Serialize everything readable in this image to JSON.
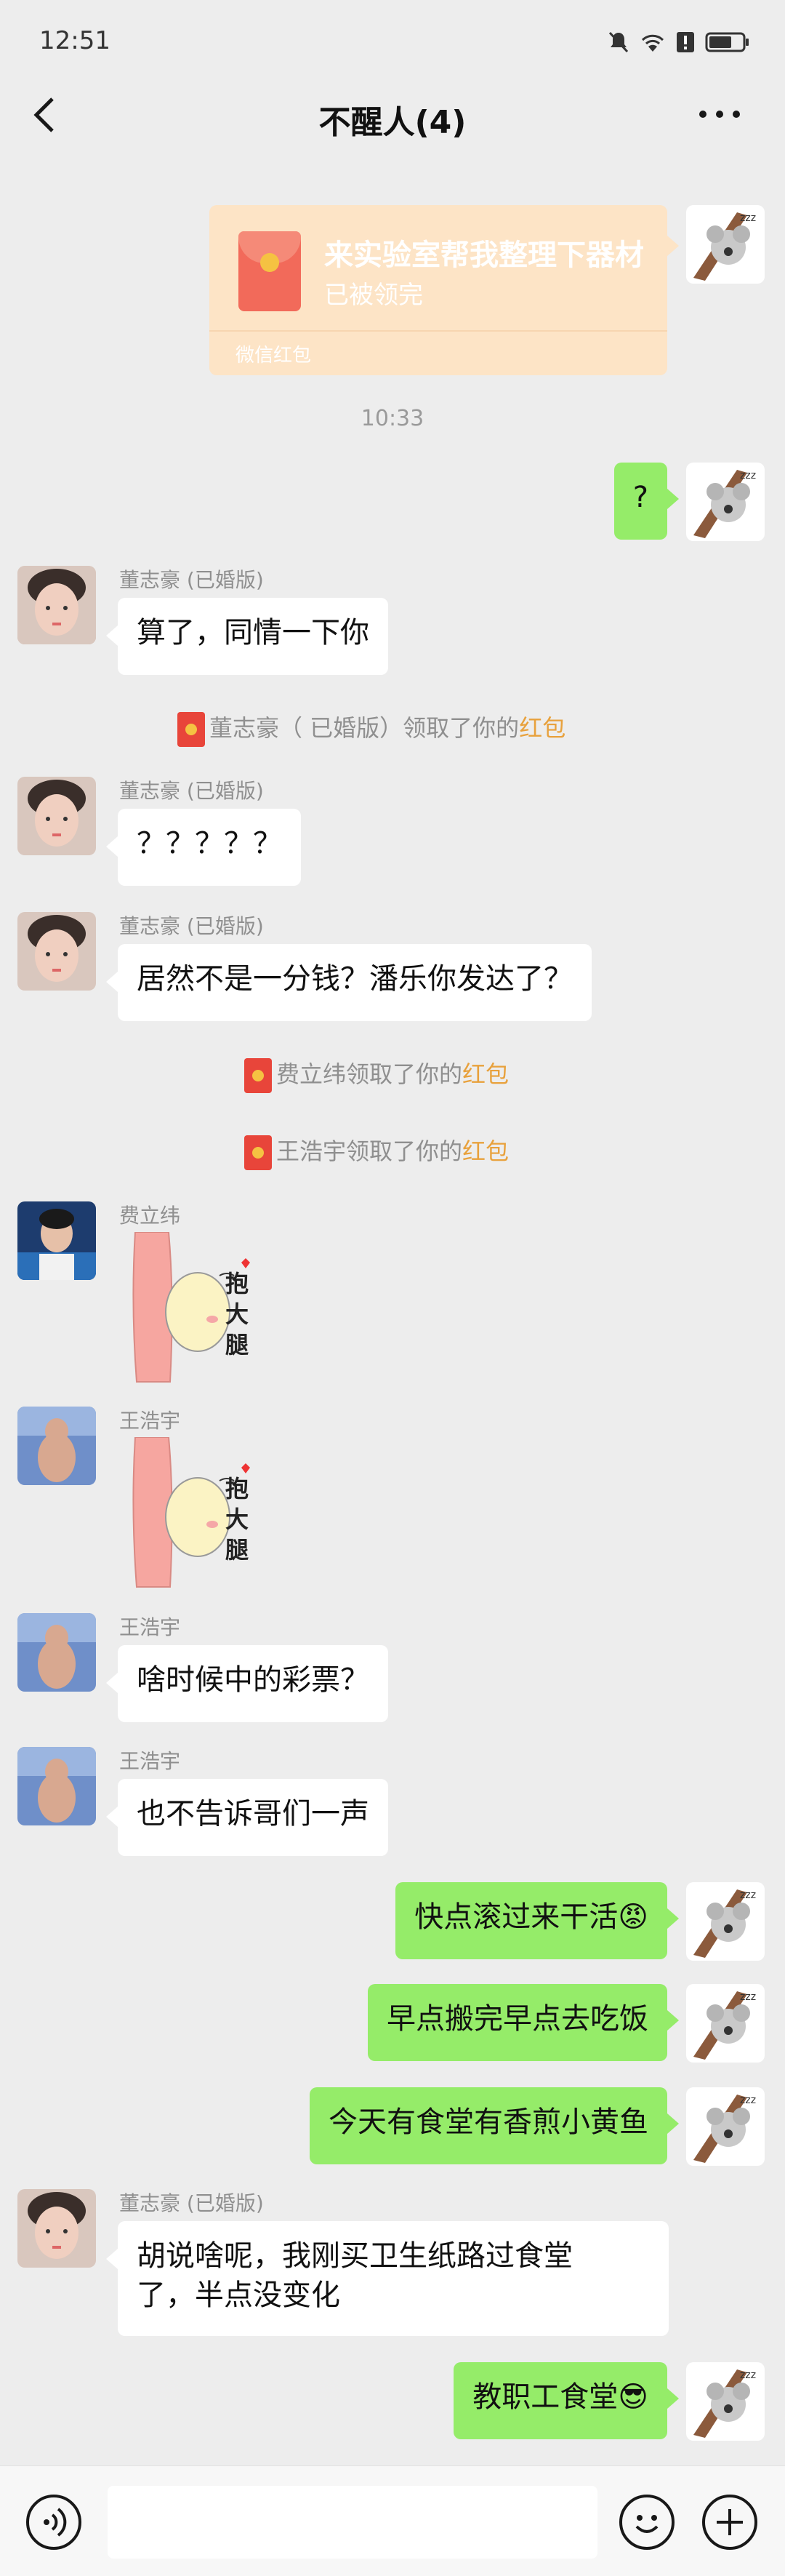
{
  "status_bar": {
    "time": "12:51"
  },
  "header": {
    "title": "不醒人(4)"
  },
  "red_packet_card": {
    "message": "来实验室帮我整理下器材",
    "status": "已被领完",
    "footer": "微信红包"
  },
  "timestamp": "10:33",
  "messages": {
    "m1": {
      "text": "?"
    },
    "m2": {
      "sender": "董志豪 (已婚版)",
      "text": "算了，同情一下你"
    },
    "s1": {
      "prefix": "董志豪（ 已婚版）领取了你的",
      "link": "红包"
    },
    "m3": {
      "sender": "董志豪 (已婚版)",
      "text": "？？？？？"
    },
    "m4": {
      "sender": "董志豪 (已婚版)",
      "text": "居然不是一分钱？潘乐你发达了？"
    },
    "s2": {
      "prefix": "费立纬领取了你的",
      "link": "红包"
    },
    "s3": {
      "prefix": "王浩宇领取了你的",
      "link": "红包"
    },
    "m5": {
      "sender": "费立纬",
      "sticker_text": "抱大腿"
    },
    "m6": {
      "sender": "王浩宇",
      "sticker_text": "抱大腿"
    },
    "m7": {
      "sender": "王浩宇",
      "text": "啥时候中的彩票？"
    },
    "m8": {
      "sender": "王浩宇",
      "text": "也不告诉哥们一声"
    },
    "m9": {
      "text": "快点滚过来干活😡"
    },
    "m10": {
      "text": "早点搬完早点去吃饭"
    },
    "m11": {
      "text": "今天有食堂有香煎小黄鱼"
    },
    "m12": {
      "sender": "董志豪 (已婚版)",
      "text_line1": "胡说啥呢，我刚买卫生纸路过食堂",
      "text_line2": "了，半点没变化"
    },
    "m13": {
      "text": "教职工食堂😎"
    }
  },
  "colors": {
    "own_bubble": "#95ec69",
    "other_bubble": "#ffffff",
    "red_packet_bg": "#fde4c6",
    "link": "#e8a13c"
  }
}
